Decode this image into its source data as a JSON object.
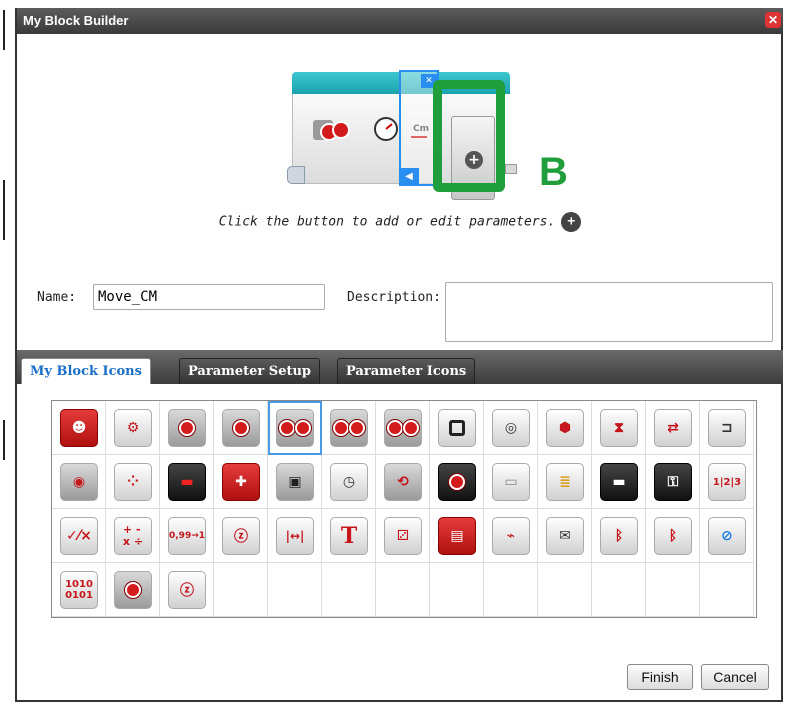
{
  "window": {
    "title": "My Block Builder",
    "close_glyph": "✕"
  },
  "preview": {
    "block_label": "Cm",
    "annotation": "B",
    "annotation_color": "#1f9e3b",
    "hint": "Click the button to add or edit parameters.",
    "plus_glyph": "+"
  },
  "form": {
    "name_label": "Name:",
    "name_value": "Move_CM",
    "description_label": "Description:",
    "description_value": ""
  },
  "tabs": [
    {
      "label": "My Block Icons",
      "active": true
    },
    {
      "label": "Parameter Setup",
      "active": false
    },
    {
      "label": "Parameter Icons",
      "active": false
    }
  ],
  "icons": {
    "row1": [
      "brain-red-icon",
      "brain-gear-icon",
      "motor-large-icon",
      "motor-medium-icon",
      "move-steering-icon",
      "move-tank-icon",
      "move-tank-gear-icon",
      "brick-display-icon",
      "sound-icon",
      "brick-buttons-icon",
      "timer-hourglass-icon",
      "loop-stop-icon",
      "sensor-icon"
    ],
    "row2": [
      "ultrasonic-icon",
      "color-sensor-icon",
      "infrared-icon",
      "remote-icon",
      "touch-sensor-icon",
      "stopwatch-icon",
      "gyro-icon",
      "motor-rotation-icon",
      "nxt-brick-icon",
      "file-stack-icon",
      "case-icon",
      "case-lock-icon",
      "array-icon"
    ],
    "row3": [
      "math-check-icon",
      "math-ops-icon",
      "round-icon",
      "random-wave-icon",
      "range-icon",
      "text-icon",
      "dice-icon",
      "file-folder-icon",
      "datalog-icon",
      "messaging-icon",
      "bluetooth-icon",
      "bluetooth-off-icon",
      "sleep-off-icon"
    ],
    "row4": [
      "binary-icon",
      "motor-rotate-icon",
      "wave-icon"
    ]
  },
  "icon_text": {
    "math_check": "✓⁄×",
    "math_ops": "+ -\nx ÷",
    "round": "0,99→1",
    "range": "|↔|",
    "text": "T",
    "array": "1|2|3",
    "binary": "1010\n0101"
  },
  "buttons": {
    "finish": "Finish",
    "cancel": "Cancel"
  },
  "colors": {
    "titlebar": "#4a4a4a",
    "active_tab_text": "#1a6fc9",
    "accent_red": "#c4161c",
    "selection_blue": "#4a9ae6"
  }
}
